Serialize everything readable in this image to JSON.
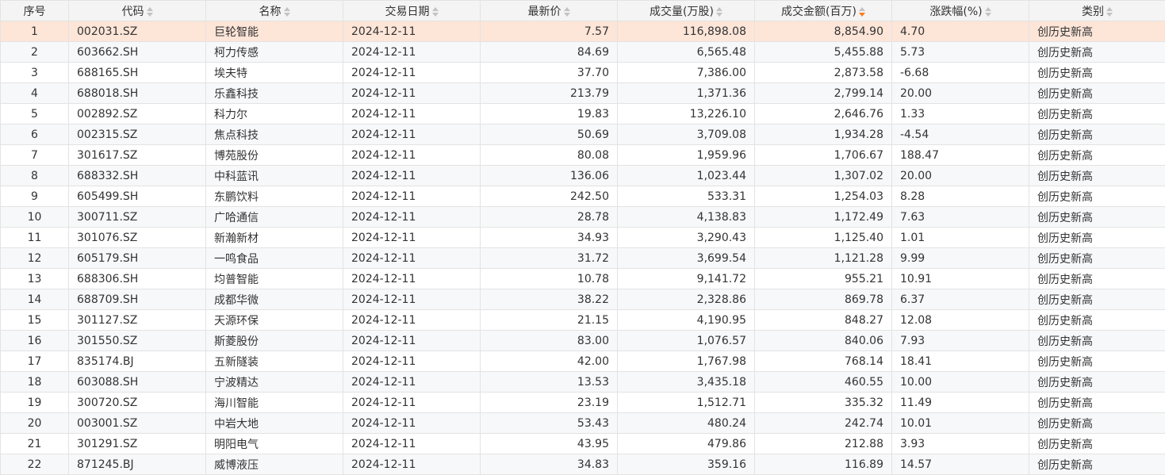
{
  "columns": {
    "idx": "序号",
    "code": "代码",
    "name": "名称",
    "date": "交易日期",
    "price": "最新价",
    "volume": "成交量(万股)",
    "amount": "成交金额(百万)",
    "change": "涨跌幅(%)",
    "category": "类别"
  },
  "rows": [
    {
      "idx": "1",
      "code": "002031.SZ",
      "name": "巨轮智能",
      "date": "2024-12-11",
      "price": "7.57",
      "volume": "116,898.08",
      "amount": "8,854.90",
      "change": "4.70",
      "category": "创历史新高"
    },
    {
      "idx": "2",
      "code": "603662.SH",
      "name": "柯力传感",
      "date": "2024-12-11",
      "price": "84.69",
      "volume": "6,565.48",
      "amount": "5,455.88",
      "change": "5.73",
      "category": "创历史新高"
    },
    {
      "idx": "3",
      "code": "688165.SH",
      "name": "埃夫特",
      "date": "2024-12-11",
      "price": "37.70",
      "volume": "7,386.00",
      "amount": "2,873.58",
      "change": "-6.68",
      "category": "创历史新高"
    },
    {
      "idx": "4",
      "code": "688018.SH",
      "name": "乐鑫科技",
      "date": "2024-12-11",
      "price": "213.79",
      "volume": "1,371.36",
      "amount": "2,799.14",
      "change": "20.00",
      "category": "创历史新高"
    },
    {
      "idx": "5",
      "code": "002892.SZ",
      "name": "科力尔",
      "date": "2024-12-11",
      "price": "19.83",
      "volume": "13,226.10",
      "amount": "2,646.76",
      "change": "1.33",
      "category": "创历史新高"
    },
    {
      "idx": "6",
      "code": "002315.SZ",
      "name": "焦点科技",
      "date": "2024-12-11",
      "price": "50.69",
      "volume": "3,709.08",
      "amount": "1,934.28",
      "change": "-4.54",
      "category": "创历史新高"
    },
    {
      "idx": "7",
      "code": "301617.SZ",
      "name": "博苑股份",
      "date": "2024-12-11",
      "price": "80.08",
      "volume": "1,959.96",
      "amount": "1,706.67",
      "change": "188.47",
      "category": "创历史新高"
    },
    {
      "idx": "8",
      "code": "688332.SH",
      "name": "中科蓝讯",
      "date": "2024-12-11",
      "price": "136.06",
      "volume": "1,023.44",
      "amount": "1,307.02",
      "change": "20.00",
      "category": "创历史新高"
    },
    {
      "idx": "9",
      "code": "605499.SH",
      "name": "东鹏饮料",
      "date": "2024-12-11",
      "price": "242.50",
      "volume": "533.31",
      "amount": "1,254.03",
      "change": "8.28",
      "category": "创历史新高"
    },
    {
      "idx": "10",
      "code": "300711.SZ",
      "name": "广哈通信",
      "date": "2024-12-11",
      "price": "28.78",
      "volume": "4,138.83",
      "amount": "1,172.49",
      "change": "7.63",
      "category": "创历史新高"
    },
    {
      "idx": "11",
      "code": "301076.SZ",
      "name": "新瀚新材",
      "date": "2024-12-11",
      "price": "34.93",
      "volume": "3,290.43",
      "amount": "1,125.40",
      "change": "1.01",
      "category": "创历史新高"
    },
    {
      "idx": "12",
      "code": "605179.SH",
      "name": "一鸣食品",
      "date": "2024-12-11",
      "price": "31.72",
      "volume": "3,699.54",
      "amount": "1,121.28",
      "change": "9.99",
      "category": "创历史新高"
    },
    {
      "idx": "13",
      "code": "688306.SH",
      "name": "均普智能",
      "date": "2024-12-11",
      "price": "10.78",
      "volume": "9,141.72",
      "amount": "955.21",
      "change": "10.91",
      "category": "创历史新高"
    },
    {
      "idx": "14",
      "code": "688709.SH",
      "name": "成都华微",
      "date": "2024-12-11",
      "price": "38.22",
      "volume": "2,328.86",
      "amount": "869.78",
      "change": "6.37",
      "category": "创历史新高"
    },
    {
      "idx": "15",
      "code": "301127.SZ",
      "name": "天源环保",
      "date": "2024-12-11",
      "price": "21.15",
      "volume": "4,190.95",
      "amount": "848.27",
      "change": "12.08",
      "category": "创历史新高"
    },
    {
      "idx": "16",
      "code": "301550.SZ",
      "name": "斯菱股份",
      "date": "2024-12-11",
      "price": "83.00",
      "volume": "1,076.57",
      "amount": "840.06",
      "change": "7.93",
      "category": "创历史新高"
    },
    {
      "idx": "17",
      "code": "835174.BJ",
      "name": "五新隧装",
      "date": "2024-12-11",
      "price": "42.00",
      "volume": "1,767.98",
      "amount": "768.14",
      "change": "18.41",
      "category": "创历史新高"
    },
    {
      "idx": "18",
      "code": "603088.SH",
      "name": "宁波精达",
      "date": "2024-12-11",
      "price": "13.53",
      "volume": "3,435.18",
      "amount": "460.55",
      "change": "10.00",
      "category": "创历史新高"
    },
    {
      "idx": "19",
      "code": "300720.SZ",
      "name": "海川智能",
      "date": "2024-12-11",
      "price": "23.19",
      "volume": "1,512.71",
      "amount": "335.32",
      "change": "11.49",
      "category": "创历史新高"
    },
    {
      "idx": "20",
      "code": "003001.SZ",
      "name": "中岩大地",
      "date": "2024-12-11",
      "price": "53.43",
      "volume": "480.24",
      "amount": "242.74",
      "change": "10.01",
      "category": "创历史新高"
    },
    {
      "idx": "21",
      "code": "301291.SZ",
      "name": "明阳电气",
      "date": "2024-12-11",
      "price": "43.95",
      "volume": "479.86",
      "amount": "212.88",
      "change": "3.93",
      "category": "创历史新高"
    },
    {
      "idx": "22",
      "code": "871245.BJ",
      "name": "威博液压",
      "date": "2024-12-11",
      "price": "34.83",
      "volume": "359.16",
      "amount": "116.89",
      "change": "14.57",
      "category": "创历史新高"
    }
  ],
  "sort": {
    "column": "amount",
    "direction": "desc",
    "active_color": "#ff7a1a"
  },
  "selected_row": 0
}
